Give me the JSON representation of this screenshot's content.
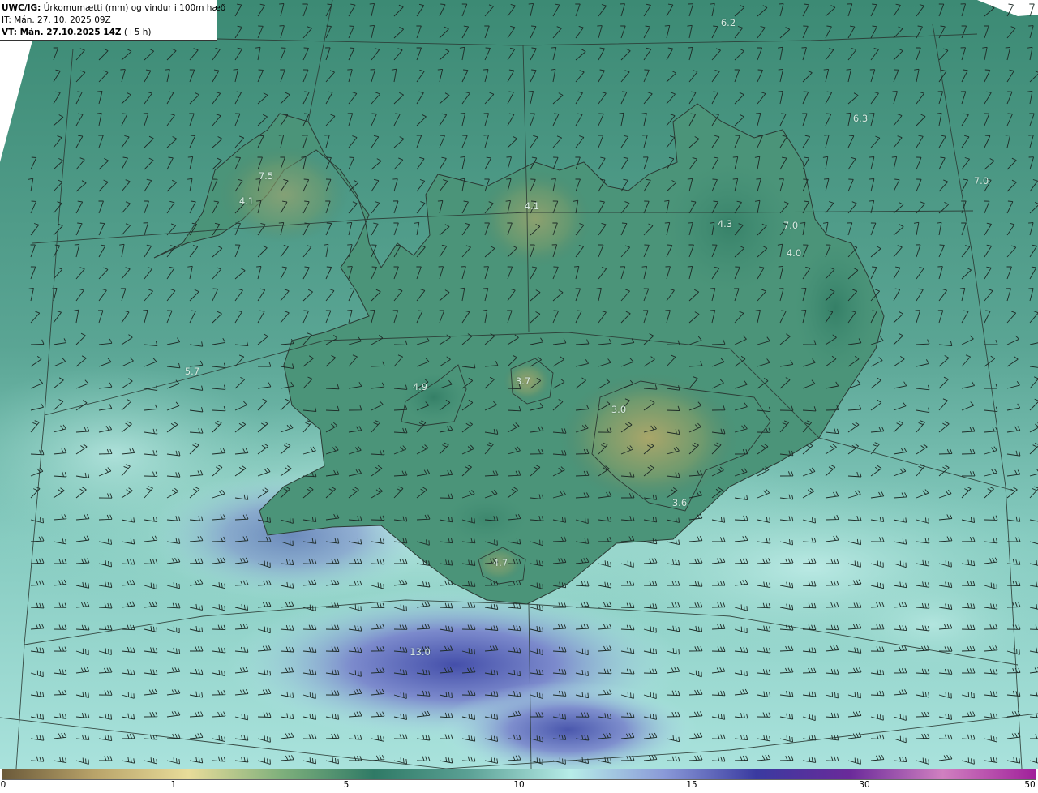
{
  "header": {
    "model_prefix": "UWC/IG:",
    "title": " Úrkomumætti (mm) og vindur i 100m hæð",
    "init_time": "IT: Mán. 27. 10. 2025 09Z",
    "valid_prefix": "VT: Mán. 27.10.2025 14Z",
    "valid_suffix": " (+5 h)"
  },
  "map_labels": [
    "6.2",
    "6.3",
    "7.0",
    "7.5",
    "4.1",
    "4.1",
    "4.3",
    "7.0",
    "4.0",
    "5.7",
    "4.9",
    "3.7",
    "3.0",
    "3.6",
    "4.7",
    "13.0"
  ],
  "colorbar": {
    "ticks": [
      "0",
      "1",
      "5",
      "10",
      "15",
      "30",
      "50"
    ],
    "colors": [
      "#6b5a3a",
      "#b9a46a",
      "#e8dc9a",
      "#7fb07c",
      "#2f7a66",
      "#5aa094",
      "#b7ece8",
      "#8a9ad8",
      "#3a3aa0",
      "#6a2a9a",
      "#d080c0",
      "#a0209a"
    ]
  }
}
